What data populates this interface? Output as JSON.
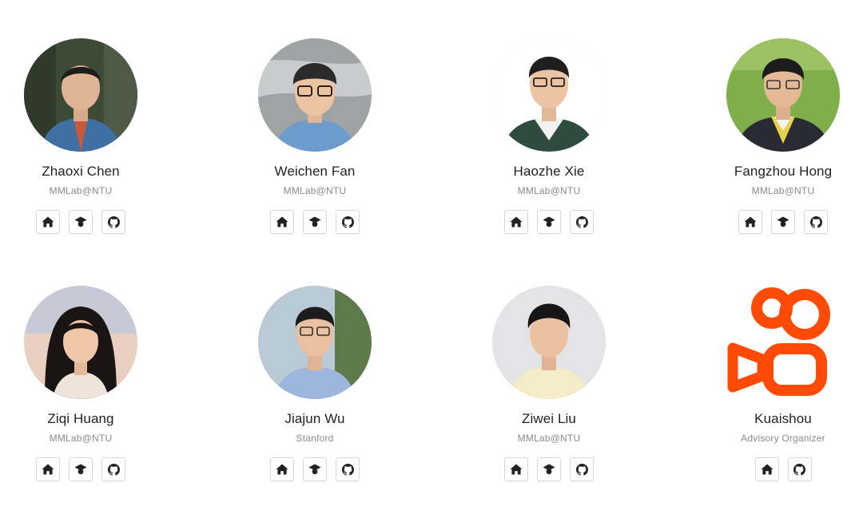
{
  "people": [
    {
      "name": "Zhaoxi Chen",
      "affiliation": "MMLab@NTU"
    },
    {
      "name": "Weichen Fan",
      "affiliation": "MMLab@NTU"
    },
    {
      "name": "Haozhe Xie",
      "affiliation": "MMLab@NTU"
    },
    {
      "name": "Fangzhou Hong",
      "affiliation": "MMLab@NTU"
    },
    {
      "name": "Ziqi Huang",
      "affiliation": "MMLab@NTU"
    },
    {
      "name": "Jiajun Wu",
      "affiliation": "Stanford"
    },
    {
      "name": "Ziwei Liu",
      "affiliation": "MMLab@NTU"
    },
    {
      "name": "Kuaishou",
      "affiliation": "Advisory Organizer"
    }
  ],
  "icons": {
    "homepage": "home-icon",
    "scholar": "graduation-cap-icon",
    "github": "github-icon",
    "logo": "kuaishou-logo"
  },
  "colors": {
    "name_text": "#222222",
    "affiliation_text": "#8a8a8a",
    "kuaishou_orange": "#ff4b06"
  }
}
